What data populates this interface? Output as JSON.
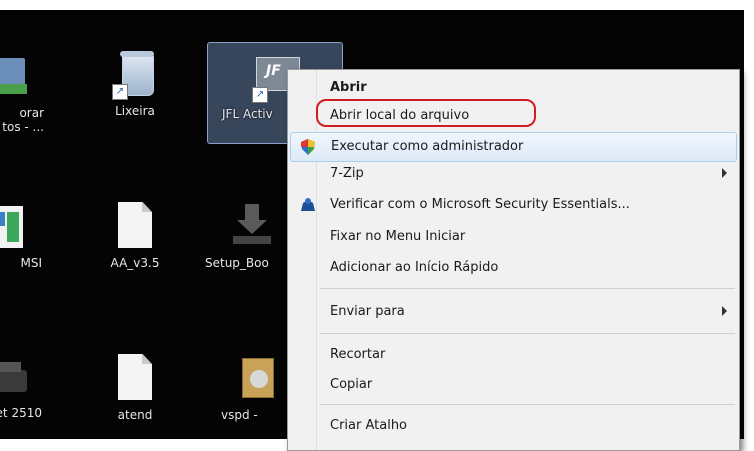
{
  "desktop": {
    "icons": [
      {
        "label_line1": "orar",
        "label_line2": "tos - ..."
      },
      {
        "label_line1": "Lixeira",
        "label_line2": ""
      },
      {
        "label_line1": "JFL Activ",
        "label_line2": ""
      },
      {
        "label_line1": "MSI",
        "label_line2": ""
      },
      {
        "label_line1": "AA_v3.5",
        "label_line2": ""
      },
      {
        "label_line1": "Setup_Boo",
        "label_line2": ""
      },
      {
        "label_line1": "et 2510",
        "label_line2": ""
      },
      {
        "label_line1": "atend",
        "label_line2": ""
      },
      {
        "label_line1": "vspd - ",
        "label_line2": ""
      }
    ]
  },
  "context_menu": {
    "items": [
      {
        "label": "Abrir",
        "icon": "none"
      },
      {
        "label": "Abrir local do arquivo",
        "icon": "none"
      },
      {
        "label": "Executar como administrador",
        "icon": "uac-shield-icon"
      },
      {
        "label": "7-Zip",
        "icon": "none",
        "submenu": true
      },
      {
        "label": "Verificar com o Microsoft Security Essentials...",
        "icon": "security-essentials-icon"
      },
      {
        "label": "Fixar no Menu Iniciar",
        "icon": "none"
      },
      {
        "label": "Adicionar ao Início Rápido",
        "icon": "none"
      },
      {
        "label": "Enviar para",
        "icon": "none",
        "submenu": true
      },
      {
        "label": "Recortar",
        "icon": "none"
      },
      {
        "label": "Copiar",
        "icon": "none"
      },
      {
        "label": "Criar Atalho",
        "icon": "none"
      }
    ]
  },
  "colors": {
    "desktop_bg": "#040404",
    "menu_bg": "#f1f1f1",
    "highlight_ring": "#d01c22",
    "hover": "#dde9f8"
  }
}
